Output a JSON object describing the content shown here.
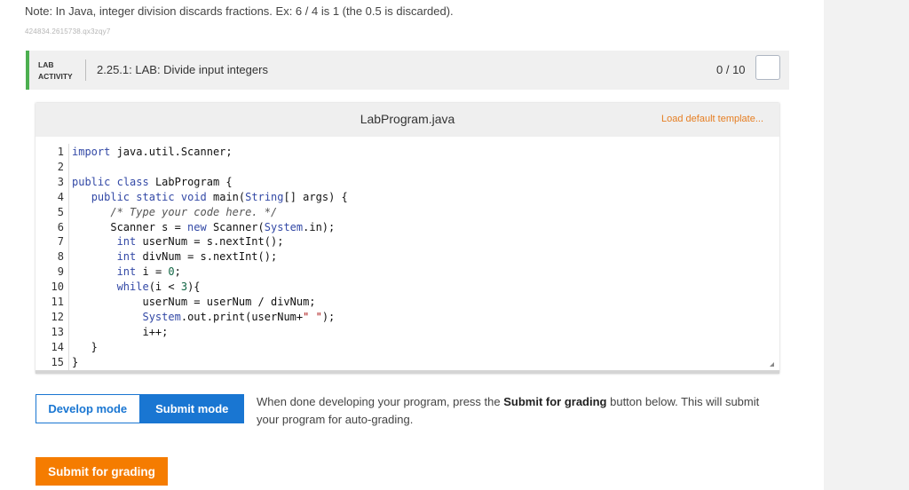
{
  "note": "Note: In Java, integer division discards fractions. Ex: 6 / 4 is 1 (the 0.5 is discarded).",
  "hash": "424834.2615738.qx3zqy7",
  "lab": {
    "tag_line1": "LAB",
    "tag_line2": "ACTIVITY",
    "title": "2.25.1: LAB: Divide input integers",
    "score": "0 / 10"
  },
  "editor": {
    "filename": "LabProgram.java",
    "load_template": "Load default template..."
  },
  "code_lines": [
    {
      "n": "1",
      "text": "import java.util.Scanner;"
    },
    {
      "n": "2",
      "text": ""
    },
    {
      "n": "3",
      "text": "public class LabProgram {"
    },
    {
      "n": "4",
      "text": "   public static void main(String[] args) {"
    },
    {
      "n": "5",
      "text": "      /* Type your code here. */"
    },
    {
      "n": "6",
      "text": "      Scanner s = new Scanner(System.in);"
    },
    {
      "n": "7",
      "text": "       int userNum = s.nextInt();"
    },
    {
      "n": "8",
      "text": "       int divNum = s.nextInt();"
    },
    {
      "n": "9",
      "text": "       int i = 0;"
    },
    {
      "n": "10",
      "text": "       while(i < 3){"
    },
    {
      "n": "11",
      "text": "           userNum = userNum / divNum;"
    },
    {
      "n": "12",
      "text": "           System.out.print(userNum+\" \");"
    },
    {
      "n": "13",
      "text": "           i++;"
    },
    {
      "n": "14",
      "text": "   }"
    },
    {
      "n": "15",
      "text": "}"
    }
  ],
  "modes": {
    "develop": "Develop mode",
    "submit": "Submit mode"
  },
  "instructions": {
    "pre": "When done developing your program, press the ",
    "bold": "Submit for grading",
    "post": " button below. This will submit your program for auto-grading."
  },
  "submit_button": "Submit for grading",
  "colors": {
    "accent_blue": "#1976d2",
    "accent_orange": "#f57c00",
    "lab_green": "#4caf50"
  }
}
